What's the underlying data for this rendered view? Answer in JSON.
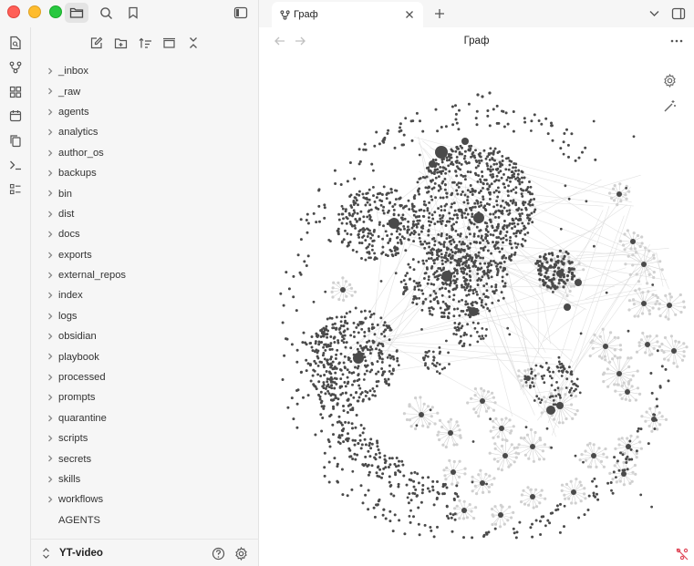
{
  "sidebar": {
    "items": [
      {
        "label": "_inbox",
        "folder": true
      },
      {
        "label": "_raw",
        "folder": true
      },
      {
        "label": "agents",
        "folder": true
      },
      {
        "label": "analytics",
        "folder": true
      },
      {
        "label": "author_os",
        "folder": true
      },
      {
        "label": "backups",
        "folder": true
      },
      {
        "label": "bin",
        "folder": true
      },
      {
        "label": "dist",
        "folder": true
      },
      {
        "label": "docs",
        "folder": true
      },
      {
        "label": "exports",
        "folder": true
      },
      {
        "label": "external_repos",
        "folder": true
      },
      {
        "label": "index",
        "folder": true
      },
      {
        "label": "logs",
        "folder": true
      },
      {
        "label": "obsidian",
        "folder": true
      },
      {
        "label": "playbook",
        "folder": true
      },
      {
        "label": "processed",
        "folder": true
      },
      {
        "label": "prompts",
        "folder": true
      },
      {
        "label": "quarantine",
        "folder": true
      },
      {
        "label": "scripts",
        "folder": true
      },
      {
        "label": "secrets",
        "folder": true
      },
      {
        "label": "skills",
        "folder": true
      },
      {
        "label": "workflows",
        "folder": true
      },
      {
        "label": "AGENTS",
        "folder": false
      }
    ]
  },
  "vault": {
    "name": "YT-video"
  },
  "tab": {
    "label": "Граф"
  },
  "view": {
    "title": "Граф"
  },
  "colors": {
    "node": "#4a4a4a",
    "edge": "#cfcfcf",
    "accent_corner": "#e04a5a"
  }
}
